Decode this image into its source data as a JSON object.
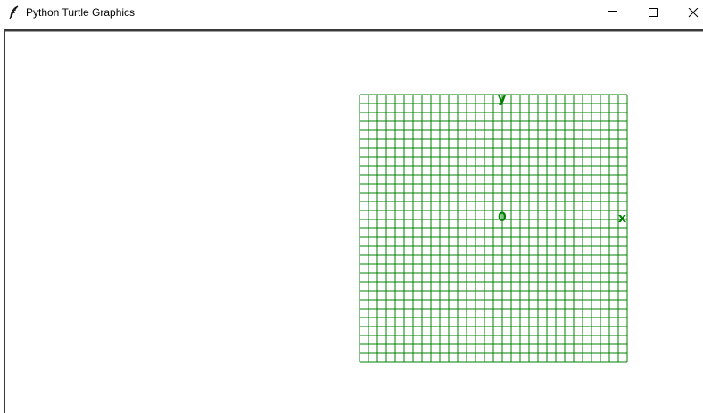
{
  "window": {
    "title": "Python Turtle Graphics",
    "icon": "feather-icon",
    "controls": [
      "minimize-icon",
      "maximize-icon",
      "close-icon"
    ]
  },
  "canvas": {
    "background": "#ffffff",
    "grid": {
      "color": "#008000",
      "cells_per_side": 30,
      "labels": {
        "y_axis": "y",
        "origin": "0",
        "x_axis": "x"
      }
    }
  }
}
